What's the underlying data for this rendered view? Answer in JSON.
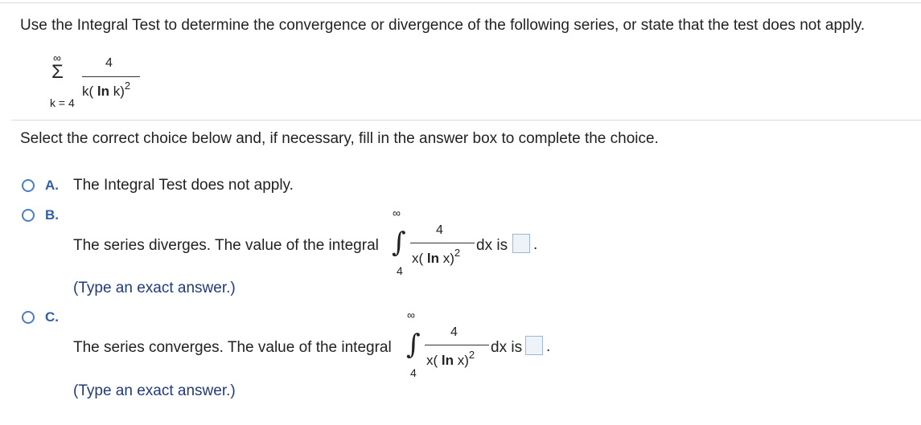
{
  "question": {
    "prompt": "Use the Integral Test to determine the convergence or divergence of the following series, or state that the test does not apply.",
    "series": {
      "upper_limit": "∞",
      "sigma_symbol": "Σ",
      "lower_limit": "k = 4",
      "numerator": "4",
      "denominator_prefix": "k(",
      "denominator_ln": "ln",
      "denominator_suffix": "k)",
      "exponent": "2"
    }
  },
  "instructions": "Select the correct choice below and, if necessary, fill in the answer box to complete the choice.",
  "choices": [
    {
      "letter": "A.",
      "text": "The Integral Test does not apply."
    },
    {
      "letter": "B.",
      "text": "The series diverges. The value of the integral",
      "integral": {
        "upper": "∞",
        "lower": "4",
        "symbol": "∫",
        "numerator": "4",
        "den_prefix": "x(",
        "den_ln": "ln",
        "den_suffix": "x)",
        "exponent": "2",
        "dx_is": "dx is"
      },
      "answer_value": "",
      "period": ".",
      "hint": "(Type an exact answer.)"
    },
    {
      "letter": "C.",
      "text": "The series converges. The value of the integral",
      "integral": {
        "upper": "∞",
        "lower": "4",
        "symbol": "∫",
        "numerator": "4",
        "den_prefix": "x(",
        "den_ln": "ln",
        "den_suffix": "x)",
        "exponent": "2",
        "dx_is": "dx is"
      },
      "answer_value": "",
      "period": ".",
      "hint": "(Type an exact answer.)"
    }
  ],
  "colors": {
    "accent_letter": "#2f5fa7",
    "radio_border": "#4a7fc1",
    "hint_text": "#233a78",
    "answer_box_fill": "#eef3f9"
  }
}
